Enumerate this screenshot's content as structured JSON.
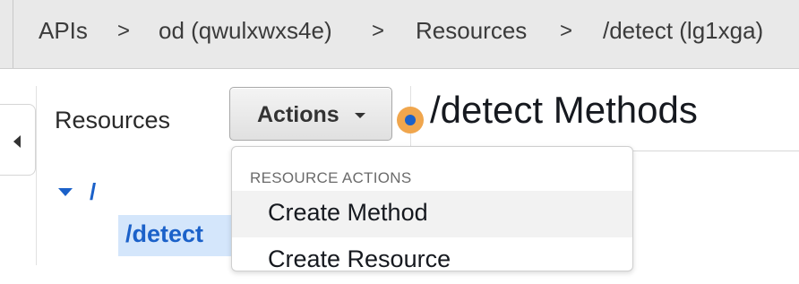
{
  "breadcrumb": {
    "items": [
      "APIs",
      "od (qwulxwxs4e)",
      "Resources",
      "/detect (lg1xga)"
    ],
    "separator": ">"
  },
  "resources_panel": {
    "title": "Resources",
    "tree": {
      "root": "/",
      "child": "/detect"
    }
  },
  "actions": {
    "label": "Actions"
  },
  "methods": {
    "title": "/detect Methods"
  },
  "dropdown": {
    "header": "RESOURCE ACTIONS",
    "items": [
      "Create Method",
      "Create Resource"
    ]
  },
  "colors": {
    "accent": "#1b61c9",
    "indicator": "#f0a64d",
    "selection": "#d4e6fb"
  }
}
